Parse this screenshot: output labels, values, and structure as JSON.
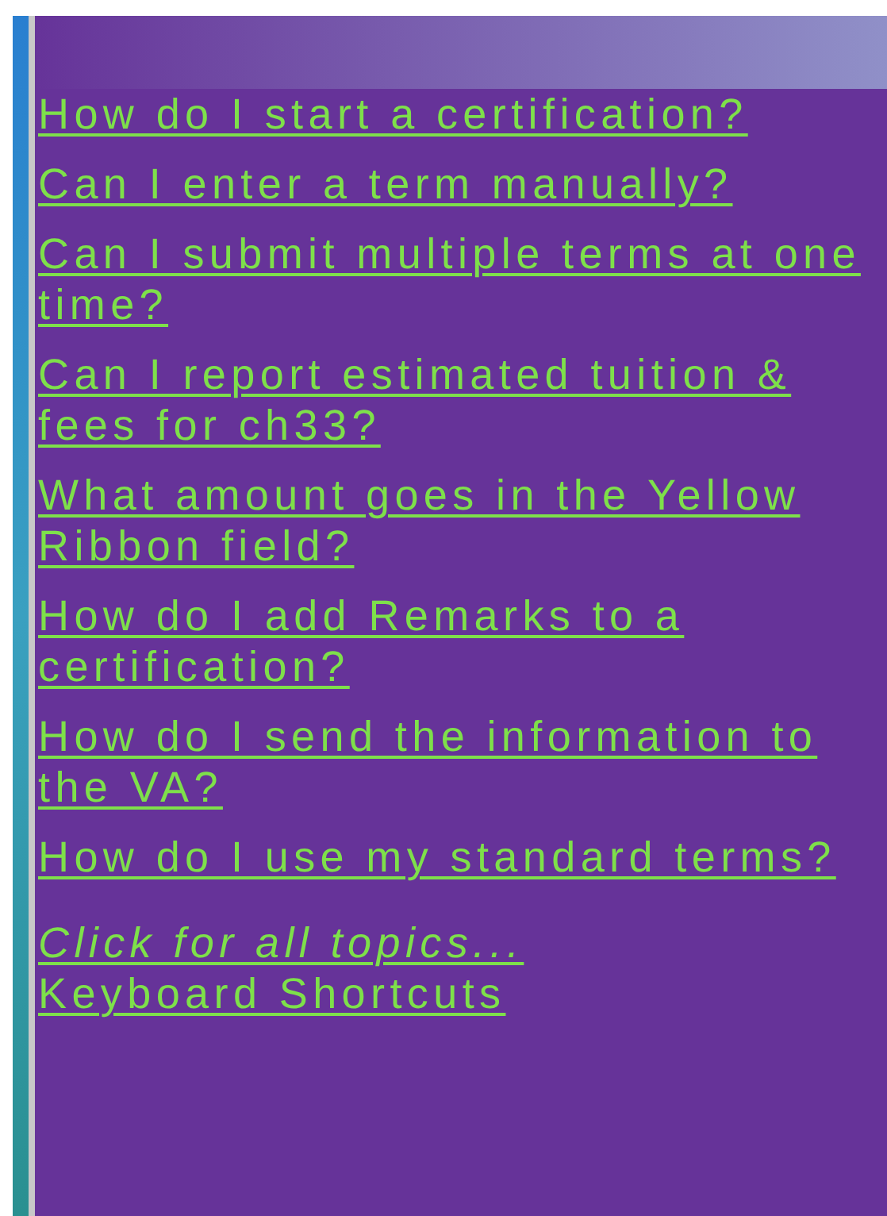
{
  "links": [
    {
      "label": "How do I start a certification?",
      "kind": "question"
    },
    {
      "label": "Can I enter a term manually?",
      "kind": "question"
    },
    {
      "label": "Can I submit multiple terms at one time?",
      "kind": "question"
    },
    {
      "label": "Can I report estimated tuition & fees for ch33?",
      "kind": "question"
    },
    {
      "label": "What amount goes in the Yellow Ribbon field?",
      "kind": "question"
    },
    {
      "label": "How do I add Remarks to a certification?",
      "kind": "question"
    },
    {
      "label": "How do I send the information to the VA?",
      "kind": "question"
    },
    {
      "label": "How do I use my standard terms?",
      "kind": "question"
    },
    {
      "label": "Click for all topics...",
      "kind": "all-topics"
    },
    {
      "label": "Keyboard Shortcuts",
      "kind": "shortcuts"
    }
  ]
}
